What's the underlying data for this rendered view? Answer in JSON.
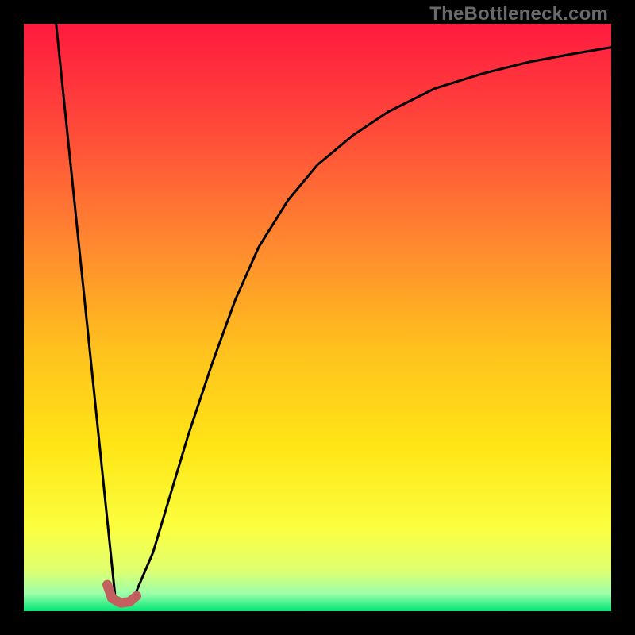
{
  "watermark": "TheBottleneck.com",
  "chart_data": {
    "type": "line",
    "title": "",
    "xlabel": "",
    "ylabel": "",
    "xlim": [
      0,
      100
    ],
    "ylim": [
      0,
      100
    ],
    "grid": false,
    "legend": false,
    "background_gradient": {
      "stops": [
        {
          "offset": 0.0,
          "color": "#ff1a3f"
        },
        {
          "offset": 0.18,
          "color": "#ff4a3a"
        },
        {
          "offset": 0.38,
          "color": "#ff8a2f"
        },
        {
          "offset": 0.55,
          "color": "#ffc01e"
        },
        {
          "offset": 0.72,
          "color": "#ffe516"
        },
        {
          "offset": 0.86,
          "color": "#fbff40"
        },
        {
          "offset": 0.93,
          "color": "#e0ff70"
        },
        {
          "offset": 0.97,
          "color": "#9cffaa"
        },
        {
          "offset": 1.0,
          "color": "#00e676"
        }
      ]
    },
    "series": [
      {
        "name": "left-line",
        "color": "#000000",
        "width": 3,
        "x": [
          5.5,
          15.5
        ],
        "values": [
          100,
          3
        ]
      },
      {
        "name": "right-curve",
        "color": "#000000",
        "width": 3,
        "x": [
          19,
          22,
          25,
          28,
          32,
          36,
          40,
          45,
          50,
          56,
          62,
          70,
          78,
          86,
          93,
          100
        ],
        "values": [
          3,
          10,
          20,
          30,
          42,
          53,
          62,
          70,
          76,
          81,
          85,
          89,
          91.5,
          93.5,
          94.8,
          96
        ]
      },
      {
        "name": "bottom-squiggle",
        "color": "#c1605e",
        "width": 12,
        "x": [
          14.2,
          15.0,
          16.5,
          18.0,
          19.2
        ],
        "values": [
          4.5,
          2.2,
          1.4,
          1.6,
          2.6
        ]
      }
    ]
  }
}
